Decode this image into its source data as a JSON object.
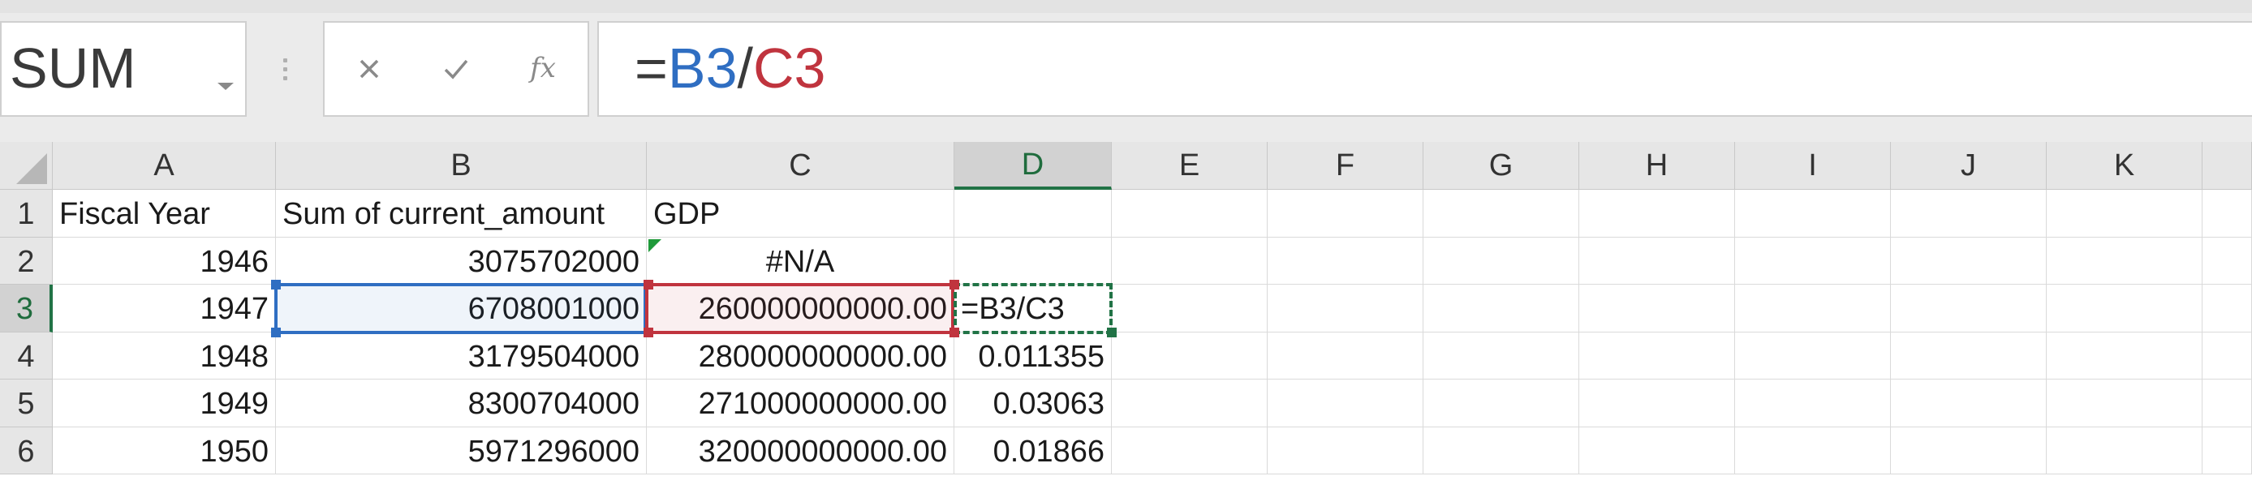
{
  "name_box": {
    "value": "SUM"
  },
  "formula_bar": {
    "prefix": "=",
    "ref1": "B3",
    "operator": "/",
    "ref2": "C3",
    "fx_label": "fx"
  },
  "colors": {
    "ref_b": "#2f6ec2",
    "ref_c": "#c0343e",
    "active": "#217346"
  },
  "columns": [
    "A",
    "B",
    "C",
    "D",
    "E",
    "F",
    "G",
    "H",
    "I",
    "J",
    "K"
  ],
  "rows": [
    {
      "num": "1",
      "A": "Fiscal Year",
      "B": "Sum of current_amount",
      "C": "GDP",
      "D": ""
    },
    {
      "num": "2",
      "A": "1946",
      "B": "3075702000",
      "C": "#N/A",
      "D": ""
    },
    {
      "num": "3",
      "A": "1947",
      "B": "6708001000",
      "C": "260000000000.00",
      "D": "=B3/C3"
    },
    {
      "num": "4",
      "A": "1948",
      "B": "3179504000",
      "C": "280000000000.00",
      "D": "0.011355"
    },
    {
      "num": "5",
      "A": "1949",
      "B": "8300704000",
      "C": "271000000000.00",
      "D": "0.03063"
    },
    {
      "num": "6",
      "A": "1950",
      "B": "5971296000",
      "C": "320000000000.00",
      "D": "0.01866"
    }
  ]
}
